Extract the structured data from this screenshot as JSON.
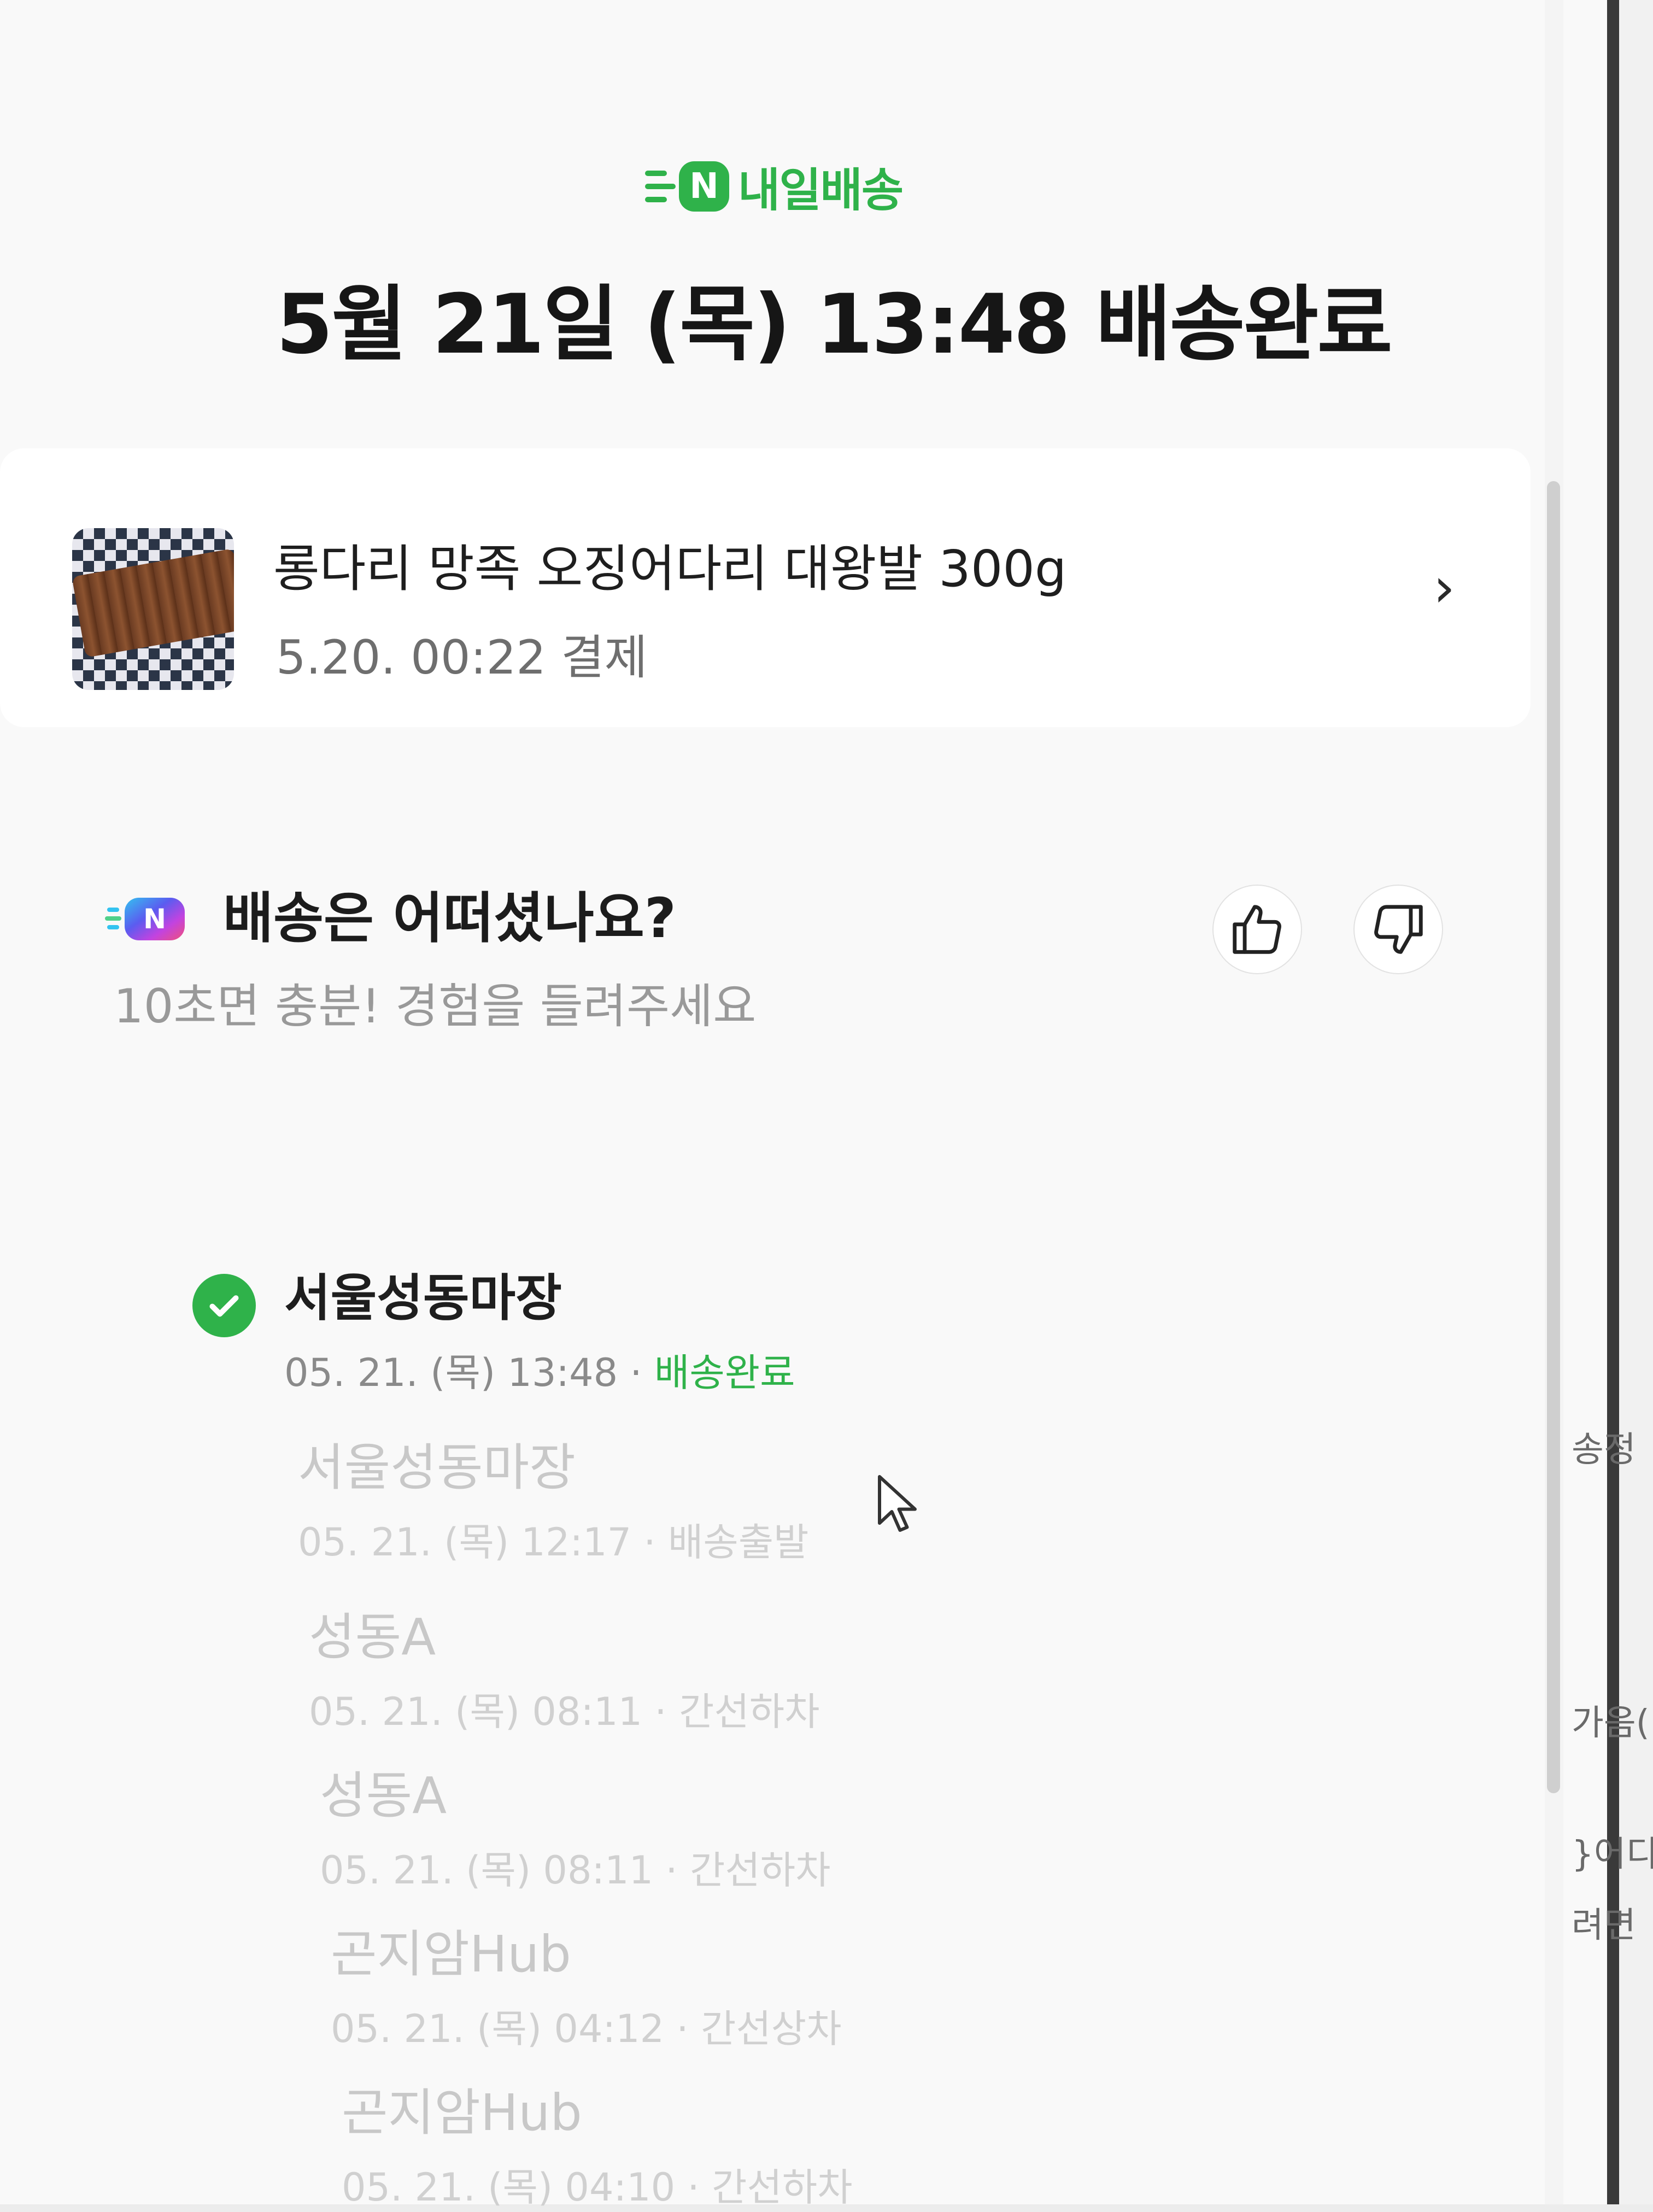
{
  "badge": {
    "logo_letter": "N",
    "label": "내일배송"
  },
  "headline": "5월 21일 (목) 13:48 배송완료",
  "product": {
    "name": "롱다리 망족 오징어다리 대왕발 300g",
    "payment": "5.20. 00:22 결제",
    "chevron": "›"
  },
  "survey": {
    "title": "배송은 어떠셨나요?",
    "subtitle": "10초면 충분! 경험을 들려주세요",
    "thumbs_up_icon": "thumbs-up-icon",
    "thumbs_down_icon": "thumbs-down-icon"
  },
  "timeline": [
    {
      "location": "서울성동마장",
      "datetime": "05. 21. (목) 13:48",
      "status": "배송완료"
    },
    {
      "location": "서울성동마장",
      "datetime": "05. 21. (목) 12:17",
      "status": "배송출발"
    },
    {
      "location": "성동A",
      "datetime": "05. 21. (목) 08:11",
      "status": "간선하차"
    },
    {
      "location": "성동A",
      "datetime": "05. 21. (목) 08:11",
      "status": "간선하차"
    },
    {
      "location": "곤지암Hub",
      "datetime": "05. 21. (목) 04:12",
      "status": "간선상차"
    },
    {
      "location": "곤지암Hub",
      "datetime": "05. 21. (목) 04:10",
      "status": "간선하차"
    }
  ],
  "right_edge_fragments": [
    "송정",
    "가음(",
    "}어디",
    "려면"
  ],
  "separator": "·",
  "colors": {
    "accent_green": "#2fb24a",
    "text_primary": "#1e1e1e",
    "text_muted": "#999999"
  }
}
